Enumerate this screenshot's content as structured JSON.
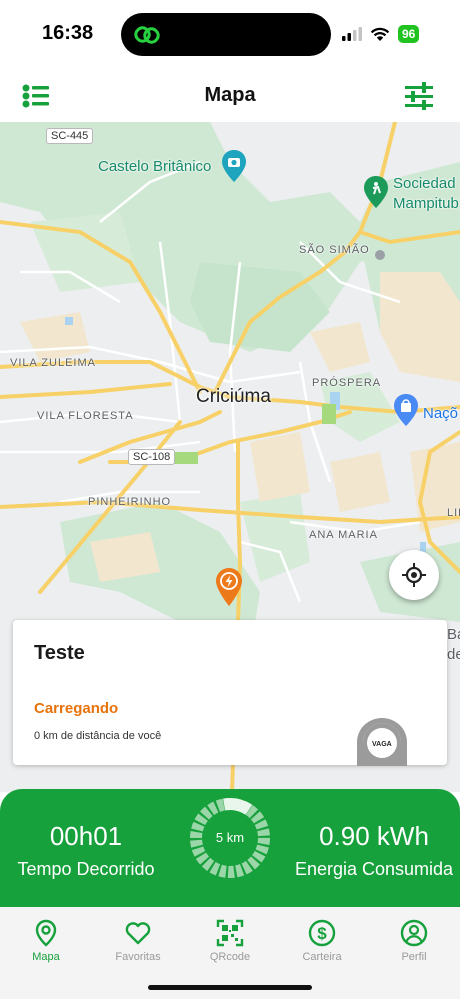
{
  "status_bar": {
    "time": "16:38",
    "battery": "96"
  },
  "header": {
    "title": "Mapa",
    "left_icon": "list-icon",
    "right_icon": "filter-sliders-icon"
  },
  "map": {
    "city": "Criciúma",
    "neighborhoods": [
      "SÃO SIMÃO",
      "VILA ZULEIMA",
      "PRÓSPERA",
      "VILA FLORESTA",
      "PINHEIRINHO",
      "ANA MARIA",
      "LIB"
    ],
    "roads": [
      "SC-445",
      "SC-108"
    ],
    "pois": [
      "Castelo Britânico",
      "Sociedad",
      "Mampitub",
      "Naçõ"
    ],
    "edge_text": [
      "Ba",
      "de"
    ]
  },
  "station_card": {
    "title": "Teste",
    "status": "Carregando",
    "distance": "0 km de distância de você",
    "logo_text": "VAGA"
  },
  "charge_panel": {
    "elapsed_value": "00h01",
    "elapsed_label": "Tempo Decorrido",
    "radius": "5 km",
    "energy_value": "0.90 kWh",
    "energy_label": "Energia Consumida"
  },
  "tabs": [
    {
      "label": "Mapa",
      "icon": "map-pin-icon",
      "active": true
    },
    {
      "label": "Favoritas",
      "icon": "heart-icon",
      "active": false
    },
    {
      "label": "QRcode",
      "icon": "qrcode-icon",
      "active": false
    },
    {
      "label": "Carteira",
      "icon": "dollar-icon",
      "active": false
    },
    {
      "label": "Perfil",
      "icon": "profile-icon",
      "active": false
    }
  ],
  "colors": {
    "brand_green": "#17a13c",
    "status_orange": "#e8730c",
    "inactive_tab": "#9a9a9a"
  }
}
